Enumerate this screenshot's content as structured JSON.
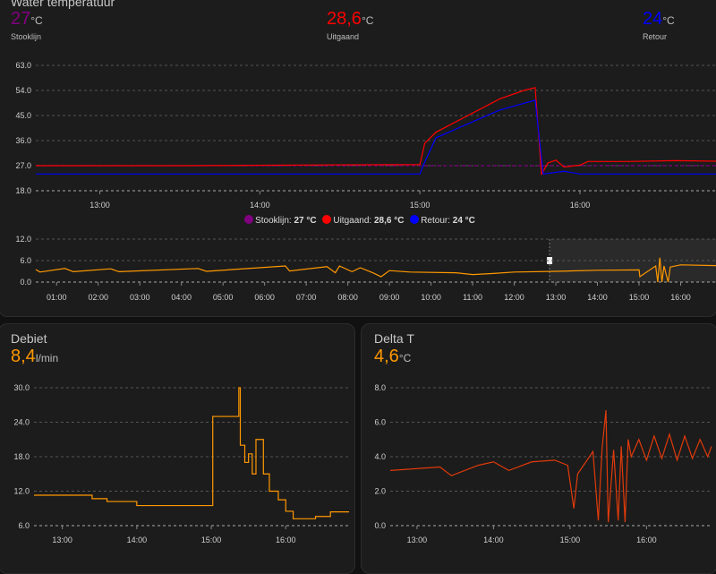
{
  "water": {
    "title": "Water temperatuur",
    "sensors": [
      {
        "label": "Stooklijn",
        "value": "27",
        "unit": "°C",
        "color": "#800080"
      },
      {
        "label": "Uitgaand",
        "value": "28,6",
        "unit": "°C",
        "color": "#ff0000"
      },
      {
        "label": "Retour",
        "value": "24",
        "unit": "°C",
        "color": "#0000ff"
      }
    ],
    "legend": [
      {
        "name": "Stooklijn:",
        "value": "27 °C"
      },
      {
        "name": "Uitgaand:",
        "value": "28,6 °C"
      },
      {
        "name": "Retour:",
        "value": "24 °C"
      }
    ]
  },
  "debiet": {
    "title": "Debiet",
    "value": "8,4",
    "unit": "l/min"
  },
  "deltat": {
    "title": "Delta T",
    "value": "4,6",
    "unit": "°C"
  },
  "chart_data": [
    {
      "id": "main",
      "type": "line",
      "xlim": [
        12.6,
        16.85
      ],
      "ylim": [
        18,
        63
      ],
      "yticks": [
        "18.0",
        "27.0",
        "36.0",
        "45.0",
        "54.0",
        "63.0"
      ],
      "yvals": [
        18,
        27,
        36,
        45,
        54,
        63
      ],
      "xticks": [
        "13:00",
        "14:00",
        "15:00",
        "16:00"
      ],
      "xvals": [
        13,
        14,
        15,
        16
      ],
      "series": [
        {
          "name": "Stooklijn",
          "color": "#800080",
          "dashed": true,
          "points": [
            [
              12.6,
              27
            ],
            [
              16.85,
              27
            ]
          ]
        },
        {
          "name": "Uitgaand",
          "color": "#ff0000",
          "points": [
            [
              12.6,
              27
            ],
            [
              13.5,
              27
            ],
            [
              14.5,
              27.3
            ],
            [
              15.0,
              27.4
            ],
            [
              15.03,
              35
            ],
            [
              15.1,
              39
            ],
            [
              15.3,
              45
            ],
            [
              15.5,
              51
            ],
            [
              15.65,
              54
            ],
            [
              15.72,
              55
            ],
            [
              15.76,
              24
            ],
            [
              15.8,
              28
            ],
            [
              15.85,
              29
            ],
            [
              15.9,
              26.5
            ],
            [
              16.0,
              27.2
            ],
            [
              16.05,
              28.5
            ],
            [
              16.3,
              28.5
            ],
            [
              16.6,
              28.8
            ],
            [
              16.85,
              28.6
            ]
          ]
        },
        {
          "name": "Retour",
          "color": "#0000ff",
          "points": [
            [
              12.6,
              24
            ],
            [
              15.0,
              24
            ],
            [
              15.02,
              27
            ],
            [
              15.1,
              37
            ],
            [
              15.3,
              42
            ],
            [
              15.5,
              47
            ],
            [
              15.72,
              50.5
            ],
            [
              15.77,
              24
            ],
            [
              15.9,
              25
            ],
            [
              16.0,
              24
            ],
            [
              16.85,
              24
            ]
          ]
        }
      ]
    },
    {
      "id": "nav",
      "type": "line",
      "xlim": [
        0.5,
        16.85
      ],
      "ylim": [
        0,
        12
      ],
      "selection": [
        12.85,
        16.85
      ],
      "yticks": [
        "0.0",
        "6.0",
        "12.0"
      ],
      "yvals": [
        0,
        6,
        12
      ],
      "xticks": [
        "01:00",
        "02:00",
        "03:00",
        "04:00",
        "05:00",
        "06:00",
        "07:00",
        "08:00",
        "09:00",
        "10:00",
        "11:00",
        "12:00",
        "13:00",
        "14:00",
        "15:00",
        "16:00"
      ],
      "xvals": [
        1,
        2,
        3,
        4,
        5,
        6,
        7,
        8,
        9,
        10,
        11,
        12,
        13,
        14,
        15,
        16
      ],
      "series": [
        {
          "name": "Debiet",
          "color": "#ff9800",
          "points": [
            [
              0.5,
              3.5
            ],
            [
              0.6,
              2.8
            ],
            [
              1.2,
              3.8
            ],
            [
              1.4,
              2.9
            ],
            [
              2.3,
              3.7
            ],
            [
              2.5,
              2.9
            ],
            [
              4.4,
              3.8
            ],
            [
              4.6,
              3.0
            ],
            [
              6.5,
              4.5
            ],
            [
              6.6,
              3.1
            ],
            [
              7.5,
              4.3
            ],
            [
              7.7,
              2.6
            ],
            [
              7.8,
              4.5
            ],
            [
              8.1,
              2.9
            ],
            [
              8.3,
              4.0
            ],
            [
              8.6,
              2.6
            ],
            [
              8.8,
              1.5
            ],
            [
              9.0,
              3.2
            ],
            [
              9.5,
              2.8
            ],
            [
              10.6,
              2.6
            ],
            [
              11.0,
              2.1
            ],
            [
              11.5,
              2.4
            ],
            [
              12.0,
              2.8
            ],
            [
              13.0,
              3.0
            ],
            [
              14.0,
              3.3
            ],
            [
              15.0,
              3.4
            ],
            [
              15.02,
              1.5
            ],
            [
              15.4,
              4.5
            ],
            [
              15.45,
              0
            ],
            [
              15.5,
              6.8
            ],
            [
              15.55,
              0
            ],
            [
              15.6,
              4.5
            ],
            [
              15.7,
              0
            ],
            [
              15.75,
              4.2
            ],
            [
              16.0,
              4.8
            ],
            [
              16.85,
              4.6
            ]
          ]
        }
      ]
    },
    {
      "id": "debiet",
      "type": "line",
      "xlim": [
        12.62,
        16.85
      ],
      "ylim": [
        6,
        30
      ],
      "yticks": [
        "6.0",
        "12.0",
        "18.0",
        "24.0",
        "30.0"
      ],
      "yvals": [
        6,
        12,
        18,
        24,
        30
      ],
      "xticks": [
        "13:00",
        "14:00",
        "15:00",
        "16:00"
      ],
      "xvals": [
        13,
        14,
        15,
        16
      ],
      "series": [
        {
          "name": "Debiet",
          "color": "#ff9800",
          "step": true,
          "points": [
            [
              12.62,
              11.3
            ],
            [
              13.4,
              10.7
            ],
            [
              13.6,
              10.2
            ],
            [
              14.0,
              9.5
            ],
            [
              15.02,
              25
            ],
            [
              15.37,
              30
            ],
            [
              15.39,
              20
            ],
            [
              15.45,
              17
            ],
            [
              15.5,
              18.5
            ],
            [
              15.55,
              15
            ],
            [
              15.6,
              21
            ],
            [
              15.7,
              15
            ],
            [
              15.78,
              12
            ],
            [
              15.9,
              10.5
            ],
            [
              16.0,
              8.5
            ],
            [
              16.1,
              7.2
            ],
            [
              16.4,
              7.6
            ],
            [
              16.6,
              8.4
            ],
            [
              16.85,
              8.4
            ]
          ]
        }
      ]
    },
    {
      "id": "deltat",
      "type": "line",
      "xlim": [
        12.65,
        16.85
      ],
      "ylim": [
        0,
        8
      ],
      "yticks": [
        "0.0",
        "2.0",
        "4.0",
        "6.0",
        "8.0"
      ],
      "yvals": [
        0,
        2,
        4,
        6,
        8
      ],
      "xticks": [
        "13:00",
        "14:00",
        "15:00",
        "16:00"
      ],
      "xvals": [
        13,
        14,
        15,
        16
      ],
      "series": [
        {
          "name": "Delta T",
          "color": "#e03a0a",
          "points": [
            [
              12.65,
              3.2
            ],
            [
              13.3,
              3.4
            ],
            [
              13.45,
              2.9
            ],
            [
              13.8,
              3.5
            ],
            [
              14.0,
              3.7
            ],
            [
              14.2,
              3.2
            ],
            [
              14.5,
              3.7
            ],
            [
              14.8,
              3.8
            ],
            [
              14.97,
              3.5
            ],
            [
              15.05,
              1.0
            ],
            [
              15.1,
              3.0
            ],
            [
              15.3,
              4.3
            ],
            [
              15.37,
              0.3
            ],
            [
              15.42,
              4.5
            ],
            [
              15.47,
              6.7
            ],
            [
              15.5,
              0.2
            ],
            [
              15.57,
              4.4
            ],
            [
              15.63,
              0.3
            ],
            [
              15.67,
              4.6
            ],
            [
              15.72,
              0.2
            ],
            [
              15.76,
              5.0
            ],
            [
              15.8,
              4.0
            ],
            [
              15.9,
              5.0
            ],
            [
              16.0,
              3.8
            ],
            [
              16.1,
              5.2
            ],
            [
              16.2,
              3.9
            ],
            [
              16.3,
              5.3
            ],
            [
              16.4,
              3.8
            ],
            [
              16.5,
              5.2
            ],
            [
              16.6,
              3.9
            ],
            [
              16.7,
              5.0
            ],
            [
              16.8,
              4.0
            ],
            [
              16.85,
              4.6
            ]
          ]
        }
      ]
    }
  ]
}
